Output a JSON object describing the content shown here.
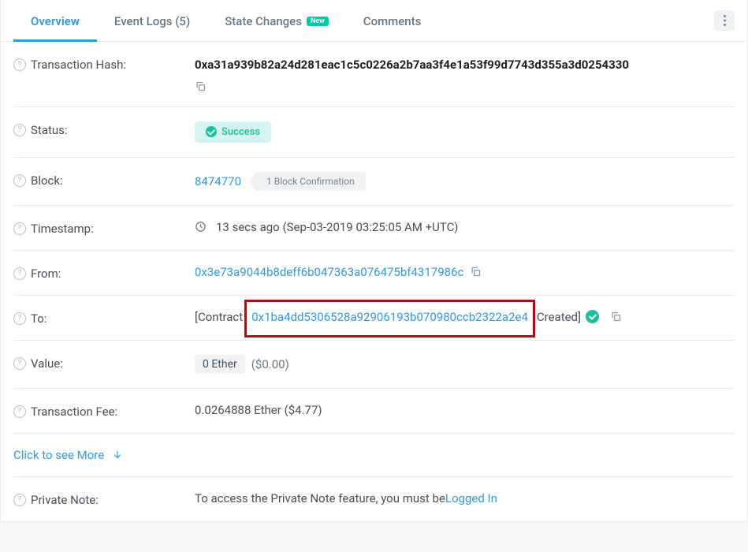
{
  "tabs": {
    "overview": "Overview",
    "event_logs": "Event Logs (5)",
    "state_changes": "State Changes",
    "state_changes_badge": "New",
    "comments": "Comments"
  },
  "rows": {
    "tx_hash": {
      "label": "Transaction Hash:",
      "value": "0xa31a939b82a24d281eac1c5c0226a2b7aa3f4e1a53f99d7743d355a3d0254330"
    },
    "status": {
      "label": "Status:",
      "value": "Success"
    },
    "block": {
      "label": "Block:",
      "number": "8474770",
      "confirmation": "1 Block Confirmation"
    },
    "timestamp": {
      "label": "Timestamp:",
      "value": "13 secs ago (Sep-03-2019 03:25:05 AM +UTC)"
    },
    "from": {
      "label": "From:",
      "address": "0x3e73a9044b8deff6b047363a076475bf4317986c"
    },
    "to": {
      "label": "To:",
      "prefix": "[Contract",
      "address": "0x1ba4dd5306528a92906193b070980ccb2322a2e4",
      "suffix": "Created]"
    },
    "value": {
      "label": "Value:",
      "ether": "0 Ether",
      "usd": "($0.00)"
    },
    "fee": {
      "label": "Transaction Fee:",
      "value": "0.0264888 Ether ($4.77)"
    },
    "private_note": {
      "label": "Private Note:",
      "text": "To access the Private Note feature, you must be ",
      "link": "Logged In"
    }
  },
  "see_more": "Click to see More"
}
